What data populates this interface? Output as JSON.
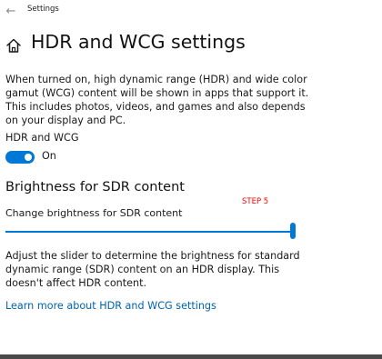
{
  "window": {
    "app_title": "Settings",
    "back_icon": "back-arrow-icon"
  },
  "header": {
    "icon": "home-icon",
    "title": "HDR and WCG settings"
  },
  "description": "When turned on, high dynamic range (HDR) and wide color gamut (WCG) content will be shown in apps that support it. This includes photos, videos, and games and also depends on your display and PC.",
  "hdr_setting": {
    "label": "HDR and WCG",
    "state": "On",
    "enabled": true
  },
  "brightness": {
    "heading": "Brightness for SDR content",
    "annotation": "STEP 5",
    "slider_label": "Change brightness for SDR content",
    "slider_value": 1.0,
    "note": "Adjust the slider to determine the brightness for standard dynamic range (SDR) content on an HDR display. This doesn't affect HDR content."
  },
  "learn_more": "Learn more about HDR and WCG settings",
  "colors": {
    "accent": "#0078d7",
    "link": "#0063b1",
    "annotation": "#ff0000"
  }
}
